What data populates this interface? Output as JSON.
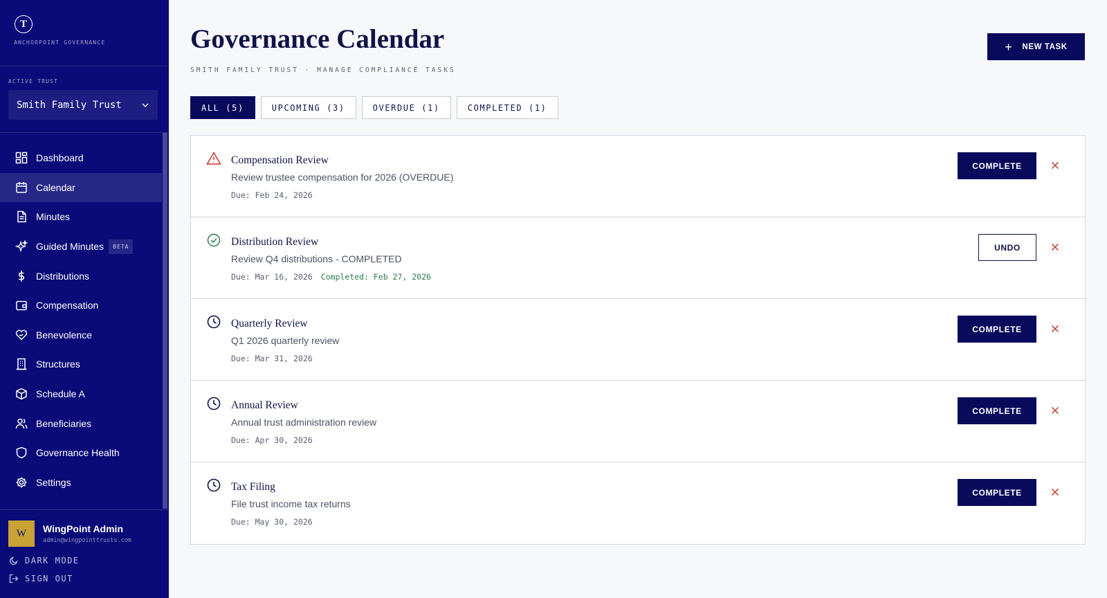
{
  "sidebar": {
    "brand": {
      "logo_letter": "T",
      "name": "ANCHORPOINT GOVERNANCE"
    },
    "trust": {
      "label": "ACTIVE TRUST",
      "selected": "Smith Family Trust"
    },
    "items": [
      {
        "label": "Dashboard",
        "icon": "dashboard-icon"
      },
      {
        "label": "Calendar",
        "icon": "calendar-icon",
        "active": true
      },
      {
        "label": "Minutes",
        "icon": "document-icon"
      },
      {
        "label": "Guided Minutes",
        "icon": "sparkle-icon",
        "badge": "BETA"
      },
      {
        "label": "Distributions",
        "icon": "dollar-icon"
      },
      {
        "label": "Compensation",
        "icon": "wallet-icon"
      },
      {
        "label": "Benevolence",
        "icon": "heart-hand-icon"
      },
      {
        "label": "Structures",
        "icon": "building-icon"
      },
      {
        "label": "Schedule A",
        "icon": "package-icon"
      },
      {
        "label": "Beneficiaries",
        "icon": "users-icon"
      },
      {
        "label": "Governance Health",
        "icon": "shield-icon"
      },
      {
        "label": "Settings",
        "icon": "gear-icon"
      }
    ],
    "user": {
      "avatar_letter": "W",
      "name": "WingPoint Admin",
      "email": "admin@wingpointtrusts.com"
    },
    "dark_mode_label": "DARK MODE",
    "sign_out_label": "SIGN OUT"
  },
  "header": {
    "title": "Governance Calendar",
    "subtitle": "SMITH FAMILY TRUST · MANAGE COMPLIANCE TASKS",
    "new_task_label": "NEW TASK"
  },
  "filters": [
    {
      "label": "ALL (5)",
      "active": true
    },
    {
      "label": "UPCOMING (3)"
    },
    {
      "label": "OVERDUE (1)"
    },
    {
      "label": "COMPLETED (1)"
    }
  ],
  "tasks": [
    {
      "title": "Compensation Review",
      "description": "Review trustee compensation for 2026 (OVERDUE)",
      "due": "Due: Feb 24, 2026",
      "completed": "",
      "status": "overdue",
      "status_icon": "warning-icon",
      "action_label": "COMPLETE"
    },
    {
      "title": "Distribution Review",
      "description": "Review Q4 distributions - COMPLETED",
      "due": "Due: Mar 16, 2026",
      "completed": "Completed: Feb 27, 2026",
      "status": "completed",
      "status_icon": "check-circle-icon",
      "action_label": "UNDO"
    },
    {
      "title": "Quarterly Review",
      "description": "Q1 2026 quarterly review",
      "due": "Due: Mar 31, 2026",
      "completed": "",
      "status": "upcoming",
      "status_icon": "clock-icon",
      "action_label": "COMPLETE"
    },
    {
      "title": "Annual Review",
      "description": "Annual trust administration review",
      "due": "Due: Apr 30, 2026",
      "completed": "",
      "status": "upcoming",
      "status_icon": "clock-icon",
      "action_label": "COMPLETE"
    },
    {
      "title": "Tax Filing",
      "description": "File trust income tax returns",
      "due": "Due: May 30, 2026",
      "completed": "",
      "status": "upcoming",
      "status_icon": "clock-icon",
      "action_label": "COMPLETE"
    }
  ],
  "colors": {
    "sidebar": "#0a0a78",
    "primary": "#0a0a5c",
    "danger": "#c0392b",
    "success": "#2e7d4f",
    "avatar": "#c8a235"
  }
}
